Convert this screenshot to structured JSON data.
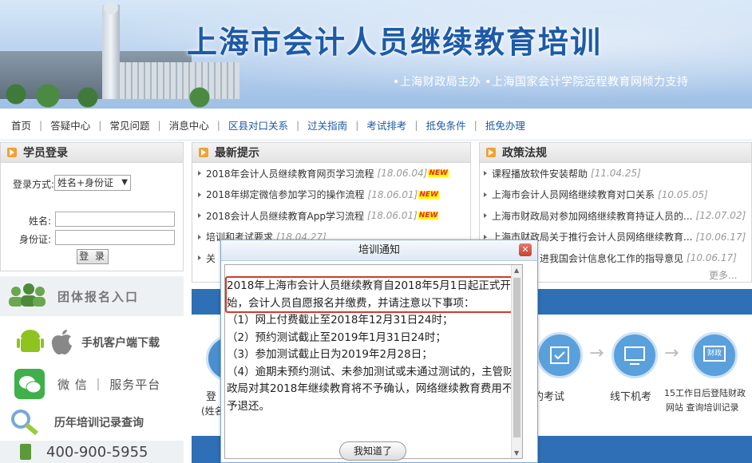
{
  "banner": {
    "title": "上海市会计人员继续教育培训",
    "subtitle": "•上海财政局主办  •上海国家会计学院远程教育网倾力支持"
  },
  "nav": {
    "items": [
      {
        "label": "首页"
      },
      {
        "label": "答疑中心"
      },
      {
        "label": "常见问题"
      },
      {
        "label": "消息中心"
      },
      {
        "label": "区县对口关系"
      },
      {
        "label": "过关指南"
      },
      {
        "label": "考试排考"
      },
      {
        "label": "抵免条件"
      },
      {
        "label": "抵免办理"
      }
    ]
  },
  "login": {
    "title": "学员登录",
    "mode_label": "登录方式:",
    "mode_value": "姓名+身份证",
    "name_label": "姓名:",
    "id_label": "身份证:",
    "button": "登 录"
  },
  "side": {
    "group_signup": "团体报名入口",
    "app_download": "手机客户端下载",
    "wechat": "微 信 ｜ 服务平台",
    "history": "历年培训记录查询",
    "phone": "400-900-5955"
  },
  "news": {
    "title": "最新提示",
    "items": [
      {
        "text": "2018年会计人员继续教育网页学习流程",
        "date": "[18.06.04]",
        "new": "NEW"
      },
      {
        "text": "2018年绑定微信参加学习的操作流程",
        "date": "[18.06.01]",
        "new": "NEW"
      },
      {
        "text": "2018会计人员继续教育App学习流程",
        "date": "[18.06.01]",
        "new": "NEW"
      },
      {
        "text": "培训和考试要求",
        "date": "[18.04.27]",
        "new": ""
      },
      {
        "text": "关",
        "date": "",
        "new": ""
      }
    ]
  },
  "policy": {
    "title": "政策法规",
    "items": [
      {
        "text": "课程播放软件安装帮助",
        "date": "[11.04.25]"
      },
      {
        "text": "上海市会计人员网络继续教育对口关系",
        "date": "[10.05.05]"
      },
      {
        "text": "上海市财政局对参加网络继续教育持证人员的...",
        "date": "[12.07.02]"
      },
      {
        "text": "上海市财政局关于推行会计人员网络继续教育...",
        "date": "[10.06.17]"
      },
      {
        "text": "进我国会计信息化工作的指导意见",
        "date": "[10.06.17]"
      }
    ],
    "more": "更多..."
  },
  "process": {
    "left_label1": "登",
    "left_label2": "(姓名",
    "step_reserve": "约考试",
    "step_offline": "线下机考",
    "step_query_line1": "15工作日后登陆财政",
    "step_query_line2": "网站  查询培训记录",
    "icon_text": "财政"
  },
  "modal": {
    "title": "培训通知",
    "paragraphs": [
      "2018年上海市会计人员继续教育自2018年5月1日起正式开始，会计人员自愿报名并缴费，并请注意以下事项：",
      "（1）网上付费截止至2018年12月31日24时；",
      "（2）预约测试截止至2019年1月31日24时；",
      "（3）参加测试截止日为2019年2月28日；",
      "（4）逾期未预约测试、未参加测试或未通过测试的，主管财政局对其2018年继续教育将不予确认，网络继续教育费用不予退还。"
    ],
    "ok_button": "我知道了",
    "close": "✕"
  },
  "colors": {
    "brand_blue": "#1d5aa8",
    "highlight_red": "#d23a2a",
    "nav_blue": "#1e5aa6"
  }
}
